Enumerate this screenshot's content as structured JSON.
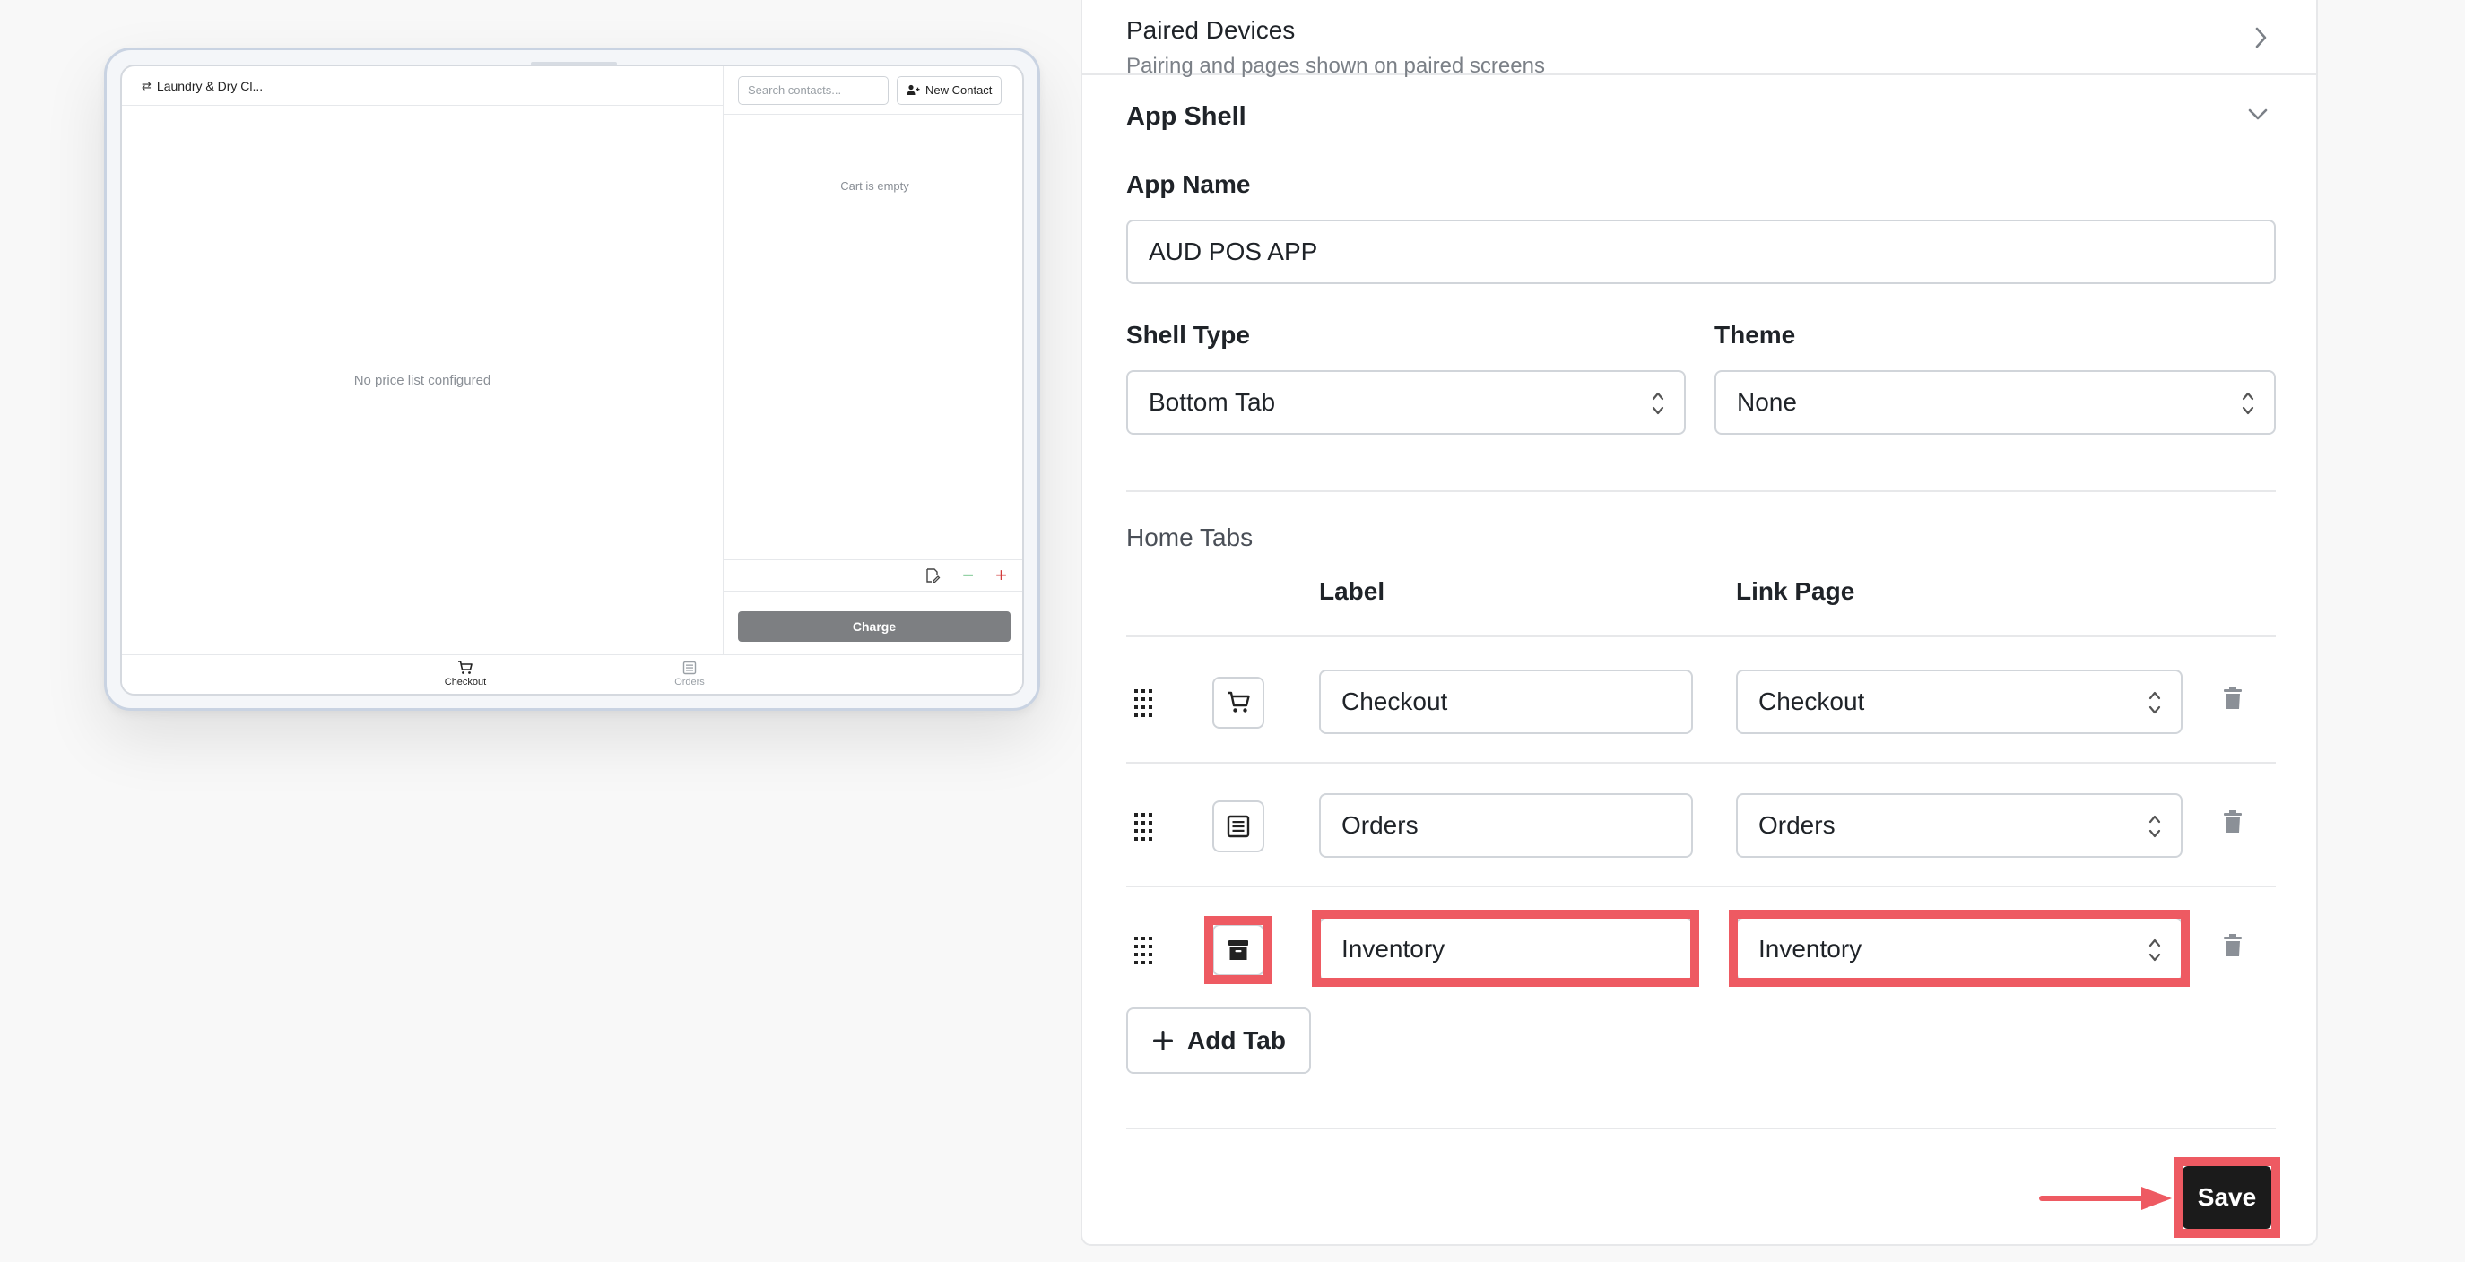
{
  "preview": {
    "header_title": "Laundry & Dry Cl...",
    "empty_price_text": "No price list configured",
    "search_placeholder": "Search contacts...",
    "new_contact_label": "New Contact",
    "cart_empty_text": "Cart is empty",
    "minus_label": "−",
    "plus_label": "+",
    "charge_label": "Charge",
    "tabs": [
      {
        "label": "Checkout",
        "icon": "cart-icon",
        "active": true
      },
      {
        "label": "Orders",
        "icon": "list-icon",
        "active": false
      }
    ]
  },
  "settings": {
    "paired_devices": {
      "title": "Paired Devices",
      "subtitle": "Pairing and pages shown on paired screens"
    },
    "app_shell": {
      "title": "App Shell",
      "app_name_label": "App Name",
      "app_name_value": "AUD POS APP",
      "shell_type_label": "Shell Type",
      "shell_type_value": "Bottom Tab",
      "theme_label": "Theme",
      "theme_value": "None"
    },
    "home_tabs": {
      "title": "Home Tabs",
      "col_label": "Label",
      "col_link_page": "Link Page",
      "rows": [
        {
          "icon": "cart-icon",
          "label": "Checkout",
          "link_page": "Checkout"
        },
        {
          "icon": "list-icon",
          "label": "Orders",
          "link_page": "Orders"
        },
        {
          "icon": "archive-icon",
          "label": "Inventory",
          "link_page": "Inventory"
        }
      ],
      "add_tab_label": "Add Tab"
    },
    "save_label": "Save"
  },
  "colors": {
    "highlight": "#ee5a62",
    "save_bg": "#1b1b1b",
    "charge_bg": "#7d7f82"
  }
}
